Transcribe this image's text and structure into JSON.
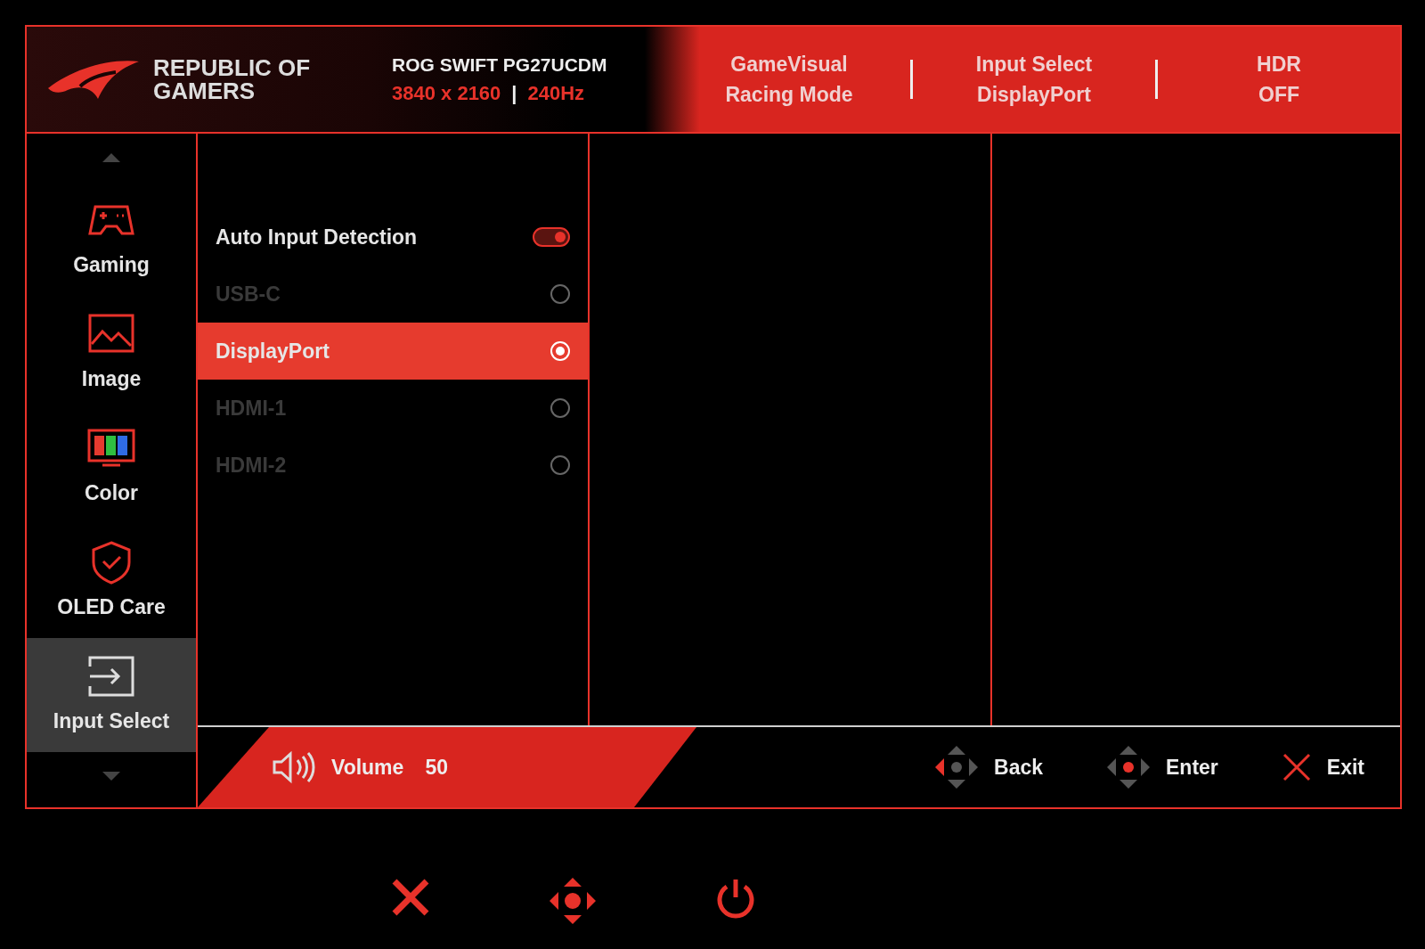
{
  "header": {
    "brand": [
      "REPUBLIC OF",
      "GAMERS"
    ],
    "model": "ROG SWIFT PG27UCDM",
    "resolution": "3840 x 2160",
    "separator": "|",
    "refresh": "240Hz",
    "status": [
      {
        "label": "GameVisual",
        "value": "Racing Mode"
      },
      {
        "label": "Input Select",
        "value": "DisplayPort"
      },
      {
        "label": "HDR",
        "value": "OFF"
      }
    ]
  },
  "sidebar": {
    "items": [
      {
        "kind": "gaming",
        "label": "Gaming",
        "selected": false
      },
      {
        "kind": "image",
        "label": "Image",
        "selected": false
      },
      {
        "kind": "color",
        "label": "Color",
        "selected": false
      },
      {
        "kind": "care",
        "label": "OLED Care",
        "selected": false
      },
      {
        "kind": "input",
        "label": "Input Select",
        "selected": true
      }
    ]
  },
  "options": [
    {
      "kind": "toggle",
      "label": "Auto Input Detection",
      "on": true,
      "disabled": false,
      "selected": false
    },
    {
      "kind": "radio",
      "label": "USB-C",
      "disabled": true,
      "selected": false
    },
    {
      "kind": "radio",
      "label": "DisplayPort",
      "disabled": false,
      "selected": true
    },
    {
      "kind": "radio",
      "label": "HDMI-1",
      "disabled": true,
      "selected": false
    },
    {
      "kind": "radio",
      "label": "HDMI-2",
      "disabled": true,
      "selected": false
    }
  ],
  "footer": {
    "volume": {
      "label": "Volume",
      "value": "50"
    },
    "hints": [
      {
        "kind": "back",
        "label": "Back"
      },
      {
        "kind": "enter",
        "label": "Enter"
      },
      {
        "kind": "exit",
        "label": "Exit"
      }
    ]
  }
}
